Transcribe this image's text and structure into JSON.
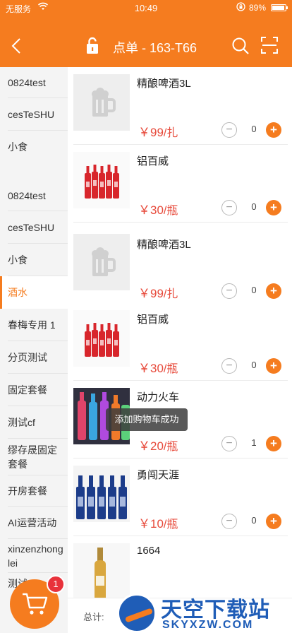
{
  "status": {
    "carrier": "无服务",
    "time": "10:49",
    "battery_text": "89%",
    "battery_level": 0.89
  },
  "header": {
    "title": "点单 - 163-T66"
  },
  "sidebar": {
    "items": [
      {
        "label": "0824test"
      },
      {
        "label": "cesTeSHU"
      },
      {
        "label": "小食"
      },
      {
        "label": "0824test"
      },
      {
        "label": "cesTeSHU"
      },
      {
        "label": "小食"
      },
      {
        "label": "酒水",
        "active": true
      },
      {
        "label": "春梅专用 1"
      },
      {
        "label": "分页测试"
      },
      {
        "label": "固定套餐"
      },
      {
        "label": "测试cf"
      },
      {
        "label": "缪存晟固定套餐"
      },
      {
        "label": "开房套餐"
      },
      {
        "label": "AI运营活动"
      },
      {
        "label": "xinzenzhonglei"
      },
      {
        "label": "测试..."
      }
    ]
  },
  "products": [
    {
      "name": "精酿啤酒3L",
      "price": "￥99",
      "unit": "/扎",
      "qty": "0",
      "image": "beer-mug-placeholder-icon"
    },
    {
      "name": "铝百威",
      "price": "￥30",
      "unit": "/瓶",
      "qty": "0",
      "image": "red-bottles-photo"
    },
    {
      "name": "精酿啤酒3L",
      "price": "￥99",
      "unit": "/扎",
      "qty": "0",
      "image": "beer-mug-placeholder-icon"
    },
    {
      "name": "铝百威",
      "price": "￥30",
      "unit": "/瓶",
      "qty": "0",
      "image": "red-bottles-photo"
    },
    {
      "name": "动力火车",
      "price": "￥20",
      "unit": "/瓶",
      "qty": "1",
      "image": "colorful-bottles-photo"
    },
    {
      "name": "勇闯天涯",
      "price": "￥10",
      "unit": "/瓶",
      "qty": "0",
      "image": "blue-bottles-photo"
    },
    {
      "name": "1664",
      "price": "",
      "unit": "",
      "qty": "",
      "image": "wine-bottle-photo"
    }
  ],
  "toast": "添加购物车成功",
  "bottom": {
    "total_label": "总计:",
    "cart_count": "1"
  },
  "watermark": {
    "brand": "天空下载站",
    "domain": "SKYXZW.COM"
  },
  "colors": {
    "accent": "#f57c1f",
    "price": "#e74a3b",
    "badge": "#e8323b",
    "brand_blue": "#1f5db7"
  }
}
